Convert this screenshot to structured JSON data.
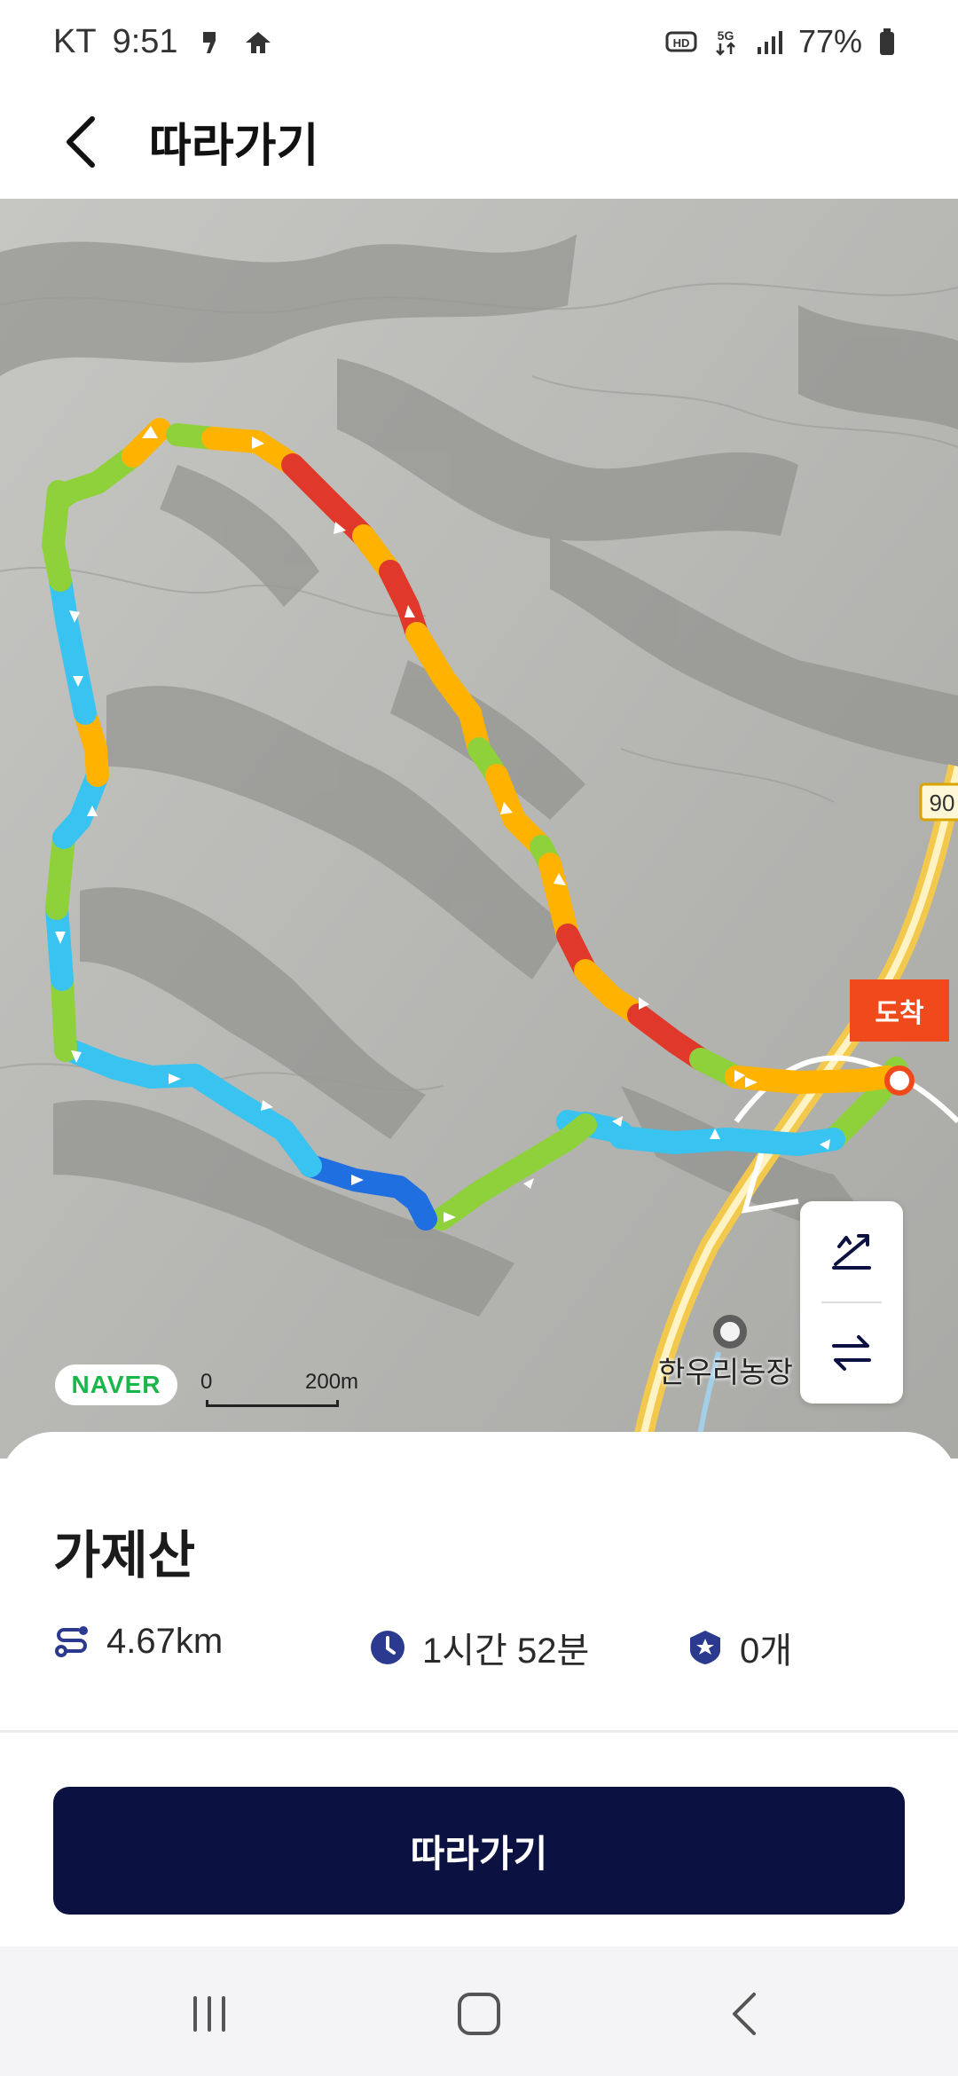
{
  "status_bar": {
    "carrier": "KT",
    "time": "9:51",
    "battery": "77%",
    "icons": [
      "notification-icon",
      "app-icon",
      "hd-icon",
      "5g-icon",
      "signal-icon",
      "battery-icon"
    ]
  },
  "header": {
    "title": "따라가기",
    "back_icon": "back-chevron-icon"
  },
  "map": {
    "arrival_label": "도착",
    "poi_label": "한우리농장",
    "road_number": "90",
    "logo": "NAVER",
    "scale_zero": "0",
    "scale_distance": "200m",
    "controls": [
      "elevation-icon",
      "swap-direction-icon"
    ],
    "route_colors": {
      "red": "#e0392b",
      "orange": "#ffb300",
      "green": "#8fd13a",
      "sky": "#38c3f0",
      "blue": "#1f6fe0"
    }
  },
  "course": {
    "name": "가제산",
    "distance": "4.67km",
    "duration": "1시간 52분",
    "badges": "0개"
  },
  "actions": {
    "follow_label": "따라가기"
  },
  "nav_bar": {
    "buttons": [
      "recents-icon",
      "home-icon",
      "back-icon"
    ]
  }
}
